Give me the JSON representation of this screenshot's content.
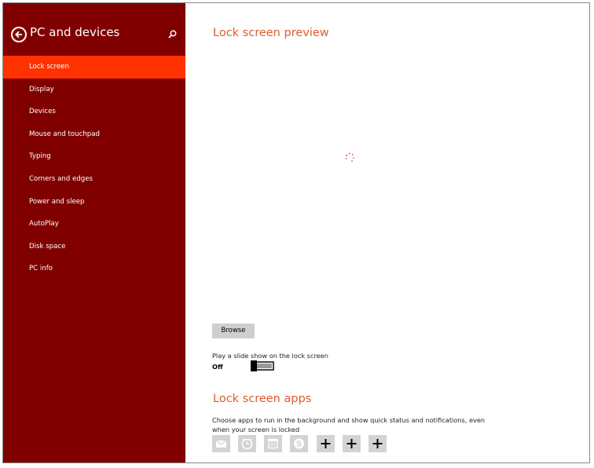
{
  "sidebar": {
    "title": "PC and devices",
    "back_icon": "back-arrow-circle-icon",
    "search_icon": "search-icon",
    "items": [
      {
        "label": "Lock screen",
        "active": true
      },
      {
        "label": "Display",
        "active": false
      },
      {
        "label": "Devices",
        "active": false
      },
      {
        "label": "Mouse and touchpad",
        "active": false
      },
      {
        "label": "Typing",
        "active": false
      },
      {
        "label": "Corners and edges",
        "active": false
      },
      {
        "label": "Power and sleep",
        "active": false
      },
      {
        "label": "AutoPlay",
        "active": false
      },
      {
        "label": "Disk space",
        "active": false
      },
      {
        "label": "PC info",
        "active": false
      }
    ]
  },
  "main": {
    "preview_title": "Lock screen preview",
    "browse_label": "Browse",
    "slideshow_label": "Play a slide show on the lock screen",
    "slideshow_state": "Off",
    "apps_title": "Lock screen apps",
    "apps_description": "Choose apps to run in the background and show quick status and notifications, even when your screen is locked",
    "app_tiles": [
      {
        "icon": "mail-icon"
      },
      {
        "icon": "alarm-icon"
      },
      {
        "icon": "calendar-icon"
      },
      {
        "icon": "skype-icon"
      },
      {
        "icon": "add-icon"
      },
      {
        "icon": "add-icon"
      },
      {
        "icon": "add-icon"
      }
    ]
  },
  "colors": {
    "sidebar_bg": "#800000",
    "active_item": "#ff3200",
    "accent_text": "#e05a2b"
  }
}
